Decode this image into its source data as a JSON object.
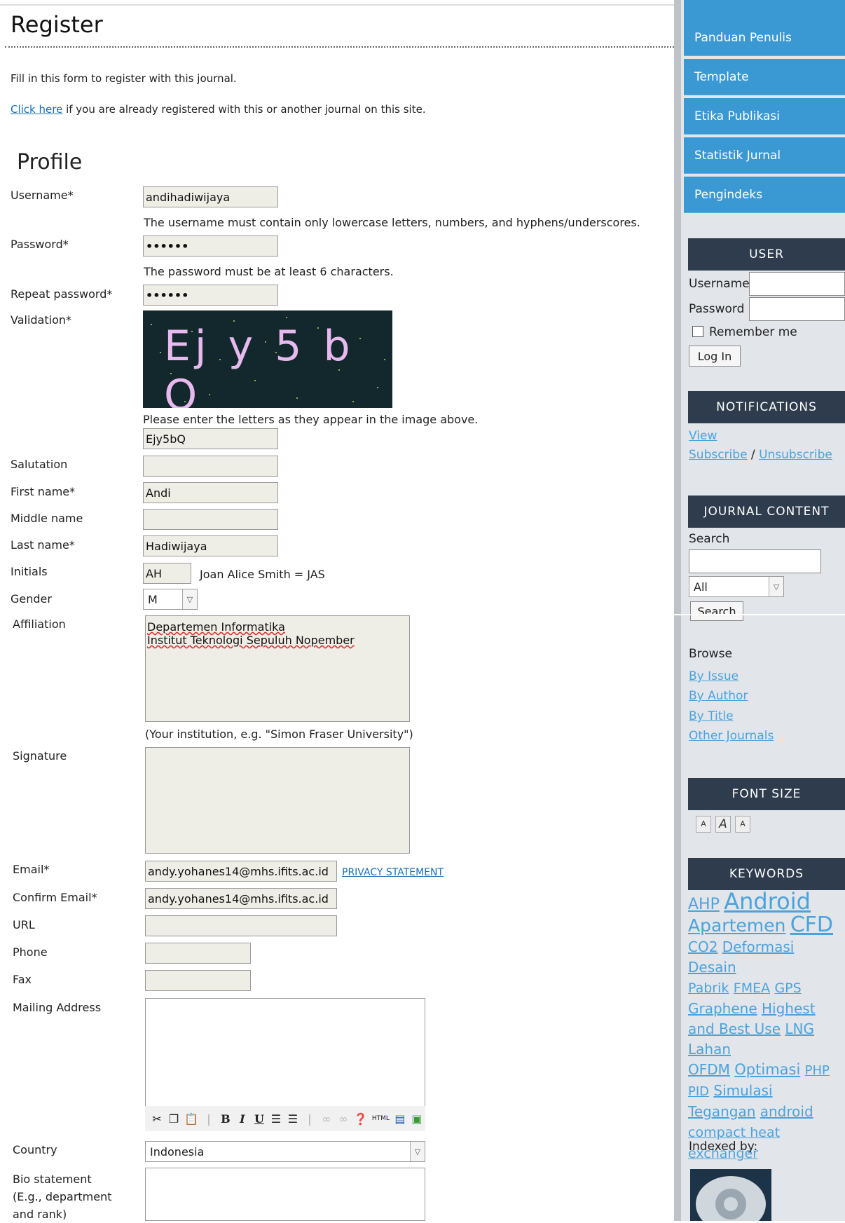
{
  "page": {
    "title": "Register",
    "intro": "Fill in this form to register with this journal.",
    "login_link": "Click here",
    "login_rest": " if you are already registered with this or another journal on this site.",
    "section_title": "Profile"
  },
  "form": {
    "username": {
      "label": "Username*",
      "value": "andihadiwijaya",
      "hint": "The username must contain only lowercase letters, numbers, and hyphens/underscores."
    },
    "password": {
      "label": "Password*",
      "value": "••••••",
      "hint": "The password must be at least 6 characters."
    },
    "repeat_password": {
      "label": "Repeat password*",
      "value": "••••••"
    },
    "validation": {
      "label": "Validation*",
      "captcha_text": "Ej y 5 b Q",
      "hint": "Please enter the letters as they appear in the image above.",
      "value": "Ejy5bQ"
    },
    "salutation": {
      "label": "Salutation",
      "value": ""
    },
    "first_name": {
      "label": "First name*",
      "value": "Andi"
    },
    "middle_name": {
      "label": "Middle name",
      "value": ""
    },
    "last_name": {
      "label": "Last name*",
      "value": "Hadiwijaya"
    },
    "initials": {
      "label": "Initials",
      "value": "AH",
      "hint": "Joan Alice Smith = JAS"
    },
    "gender": {
      "label": "Gender",
      "value": "M"
    },
    "affiliation": {
      "label": "Affiliation",
      "value": "Departemen Informatika\nInstitut Teknologi Sepuluh Nopember",
      "hint": "(Your institution, e.g. \"Simon Fraser University\")"
    },
    "signature": {
      "label": "Signature",
      "value": ""
    },
    "email": {
      "label": "Email*",
      "value": "andy.yohanes14@mhs.ifits.ac.id",
      "privacy": "PRIVACY STATEMENT"
    },
    "confirm_email": {
      "label": "Confirm Email*",
      "value": "andy.yohanes14@mhs.ifits.ac.id"
    },
    "url": {
      "label": "URL",
      "value": ""
    },
    "phone": {
      "label": "Phone",
      "value": ""
    },
    "fax": {
      "label": "Fax",
      "value": ""
    },
    "mailing_address": {
      "label": "Mailing Address",
      "value": ""
    },
    "country": {
      "label": "Country",
      "value": "Indonesia"
    },
    "bio": {
      "label": "Bio statement\n(E.g., department\nand rank)",
      "value": ""
    },
    "toolbar_icons": [
      "cut-icon",
      "copy-icon",
      "paste-icon",
      "bold-icon",
      "italic-icon",
      "underline-icon",
      "bullet-list-icon",
      "numbered-list-icon",
      "link-icon",
      "unlink-icon",
      "help-icon",
      "html-icon",
      "fullscreen-icon",
      "image-icon"
    ]
  },
  "sidebar": {
    "menu": [
      "Panduan Penulis",
      "Template",
      "Etika Publikasi",
      "Statistik Jurnal",
      "Pengindeks"
    ],
    "user": {
      "title": "USER",
      "username_label": "Username",
      "password_label": "Password",
      "remember": "Remember me",
      "login_button": "Log In"
    },
    "notifications": {
      "title": "NOTIFICATIONS",
      "view": "View",
      "subscribe": "Subscribe",
      "sep": " / ",
      "unsubscribe": "Unsubscribe"
    },
    "journal_content": {
      "title": "JOURNAL CONTENT",
      "search_label": "Search",
      "scope": "All",
      "search_button": "Search"
    },
    "browse": {
      "title": "Browse",
      "links": [
        "By Issue",
        "By Author",
        "By Title",
        "Other Journals"
      ]
    },
    "font_size": {
      "title": "FONT SIZE"
    },
    "keywords": {
      "title": "KEYWORDS",
      "items": [
        "AHP",
        "Android",
        "Apartemen",
        "CFD",
        "CO2",
        "Deformasi",
        "Desain",
        "Pabrik",
        "FMEA",
        "GPS",
        "Graphene",
        "Highest and Best Use",
        "LNG",
        "Lahan",
        "OFDM",
        "Optimasi",
        "PHP",
        "PID",
        "Simulasi",
        "Tegangan",
        "android",
        "compact heat exchanger"
      ]
    },
    "indexed_by": "Indexed by:"
  },
  "colors": {
    "menu_bg": "#3a98d3",
    "block_title_bg": "#2e3c4d",
    "link": "#1a6fb5",
    "sidebar_link": "#4aa3dd"
  }
}
